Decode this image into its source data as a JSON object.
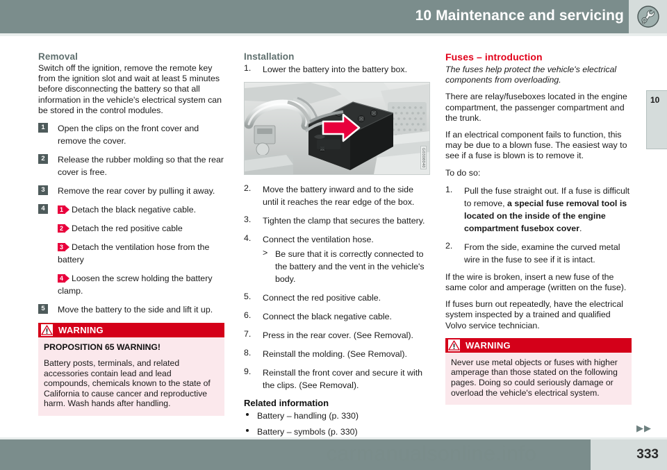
{
  "header": {
    "title": "10 Maintenance and servicing",
    "icon": "wrench-icon",
    "chapter_tab": "10",
    "bg_color": "#7b8d8c"
  },
  "col1": {
    "heading": "Removal",
    "intro": "Switch off the ignition, remove the remote key from the ignition slot and wait at least 5 minutes before disconnecting the battery so that all information in the vehicle's electrical system can be stored in the control modules.",
    "steps": [
      {
        "num": "1",
        "text": "Open the clips on the front cover and remove the cover."
      },
      {
        "num": "2",
        "text": "Release the rubber molding so that the rear cover is free."
      },
      {
        "num": "3",
        "text": "Remove the rear cover by pulling it away."
      }
    ],
    "step4_num": "4",
    "arrow_items": [
      {
        "num": "1",
        "text": "Detach the black negative cable."
      },
      {
        "num": "2",
        "text": "Detach the red positive cable"
      },
      {
        "num": "3",
        "text": "Detach the ventilation hose from the battery"
      },
      {
        "num": "4",
        "text": "Loosen the screw holding the battery clamp."
      }
    ],
    "step5": {
      "num": "5",
      "text": "Move the battery to the side and lift it up."
    },
    "warning": {
      "label": "WARNING",
      "strong": "PROPOSITION 65 WARNING!",
      "text": "Battery posts, terminals, and related accessories contain lead and lead compounds, chemicals known to the state of California to cause cancer and reproductive harm. Wash hands after handling."
    }
  },
  "col2": {
    "heading": "Installation",
    "step1": {
      "num": "1.",
      "text": "Lower the battery into the battery box."
    },
    "figure": {
      "alt": "Car battery in engine compartment with red arrow pointing right",
      "watermark": "G0308040"
    },
    "steps": [
      {
        "num": "2.",
        "text": "Move the battery inward and to the side until it reaches the rear edge of the box."
      },
      {
        "num": "3.",
        "text": "Tighten the clamp that secures the battery."
      },
      {
        "num": "4.",
        "text": "Connect the ventilation hose.",
        "sub_mark": ">",
        "sub": "Be sure that it is correctly connected to the battery and the vent in the vehicle's body."
      },
      {
        "num": "5.",
        "text": "Connect the red positive cable."
      },
      {
        "num": "6.",
        "text": "Connect the black negative cable."
      },
      {
        "num": "7.",
        "text": "Press in the rear cover. (See Removal)."
      },
      {
        "num": "8.",
        "text": "Reinstall the molding. (See Removal)."
      },
      {
        "num": "9.",
        "text": "Reinstall the front cover and secure it with the clips. (See Removal)."
      }
    ],
    "related_heading": "Related information",
    "related": [
      "Battery – handling (p. 330)",
      "Battery – symbols (p. 330)"
    ]
  },
  "col3": {
    "heading": "Fuses – introduction",
    "italic": "The fuses help protect the vehicle's electrical components from overloading.",
    "p1": "There are relay/fuseboxes located in the engine compartment, the passenger compartment and the trunk.",
    "p2": "If an electrical component fails to function, this may be due to a blown fuse. The easiest way to see if a fuse is blown is to remove it.",
    "p3": "To do so:",
    "steps": [
      {
        "num": "1.",
        "pre": "Pull the fuse straight out. If a fuse is difficult to remove, ",
        "bold": "a special fuse removal tool is located on the inside of the engine compartment fusebox cover",
        "post": "."
      },
      {
        "num": "2.",
        "pre": "From the side, examine the curved metal wire in the fuse to see if it is intact.",
        "bold": "",
        "post": ""
      }
    ],
    "p4": "If the wire is broken, insert a new fuse of the same color and amperage (written on the fuse).",
    "p5": "If fuses burn out repeatedly, have the electrical system inspected by a trained and qualified Volvo service technician.",
    "warning": {
      "label": "WARNING",
      "text": "Never use metal objects or fuses with higher amperage than those stated on the following pages. Doing so could seriously damage or overload the vehicle's electrical system."
    }
  },
  "footer": {
    "page_number": "333",
    "next_marks": "▶▶",
    "watermark": "carmanualsonline.info"
  },
  "colors": {
    "header_bg": "#7b8d8c",
    "tab_bg": "#d5dcdb",
    "warning_red": "#d40019",
    "warning_bg": "#fbe8ec",
    "heading_red": "#e1001a",
    "heading_gray": "#5f6f6e",
    "badge_gray": "#4e5b5b",
    "arrow_red": "#e8003c"
  }
}
